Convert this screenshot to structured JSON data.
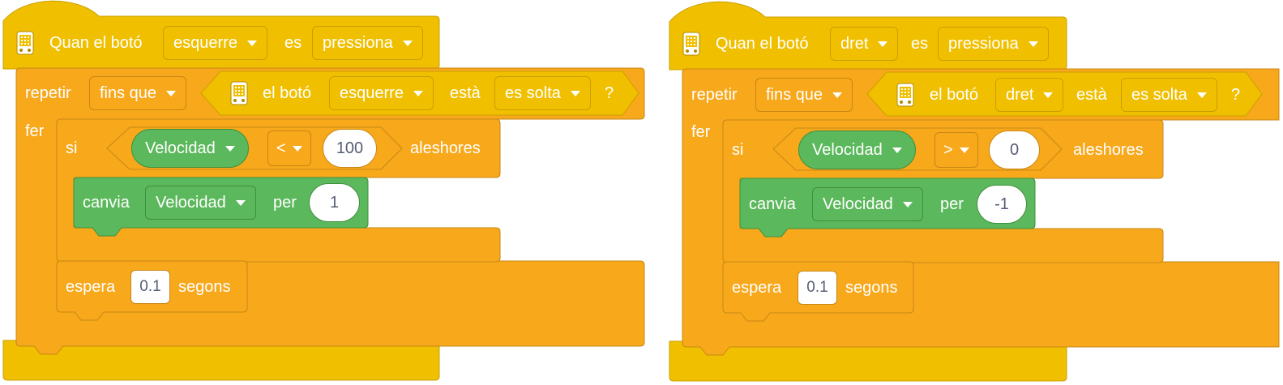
{
  "colors": {
    "events": "#f0c000",
    "control": "#f7a81b",
    "variables": "#5cb85c",
    "input_text": "#575e75"
  },
  "scripts": [
    {
      "hat": {
        "icon": "microbit-icon",
        "text1": "Quan el botó",
        "button": "esquerre",
        "text2": "es",
        "action": "pressiona"
      },
      "repeat": {
        "label": "repetir",
        "mode": "fins que",
        "do_label": "fer"
      },
      "condition": {
        "icon": "microbit-icon",
        "text1": "el botó",
        "button": "esquerre",
        "text2": "està",
        "state": "es solta",
        "suffix": "?"
      },
      "if": {
        "label": "si",
        "variable": "Velocidad",
        "operator": "<",
        "value": "100",
        "then_label": "aleshores"
      },
      "change": {
        "label": "canvia",
        "variable": "Velocidad",
        "by_label": "per",
        "value": "1"
      },
      "wait": {
        "label": "espera",
        "value": "0.1",
        "unit": "segons"
      }
    },
    {
      "hat": {
        "icon": "microbit-icon",
        "text1": "Quan el botó",
        "button": "dret",
        "text2": "es",
        "action": "pressiona"
      },
      "repeat": {
        "label": "repetir",
        "mode": "fins que",
        "do_label": "fer"
      },
      "condition": {
        "icon": "microbit-icon",
        "text1": "el botó",
        "button": "dret",
        "text2": "està",
        "state": "es solta",
        "suffix": "?"
      },
      "if": {
        "label": "si",
        "variable": "Velocidad",
        "operator": ">",
        "value": "0",
        "then_label": "aleshores"
      },
      "change": {
        "label": "canvia",
        "variable": "Velocidad",
        "by_label": "per",
        "value": "-1"
      },
      "wait": {
        "label": "espera",
        "value": "0.1",
        "unit": "segons"
      }
    }
  ]
}
